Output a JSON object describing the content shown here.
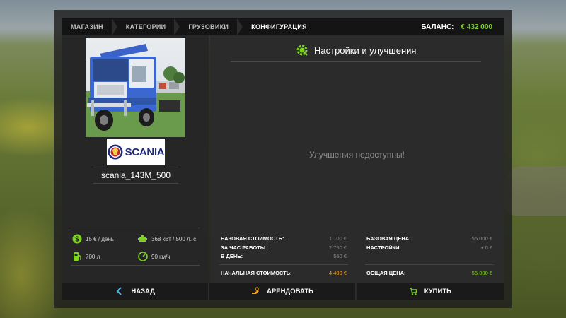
{
  "breadcrumbs": [
    {
      "label": "МАГАЗИН"
    },
    {
      "label": "КАТЕГОРИИ"
    },
    {
      "label": "ГРУЗОВИКИ"
    },
    {
      "label": "КОНФИГУРАЦИЯ"
    }
  ],
  "balance": {
    "label": "БАЛАНС:",
    "value": "€ 432 000"
  },
  "vehicle": {
    "brand": "SCANIA",
    "model": "scania_143M_500",
    "specs": {
      "upkeep": "15 € / день",
      "power": "368 кВт / 500 л. с.",
      "fuel": "700 л",
      "speed": "90 км/ч"
    }
  },
  "settings": {
    "title": "Настройки и улучшения",
    "empty_message": "Улучшения недоступны!"
  },
  "lease": {
    "base_cost_label": "БАЗОВАЯ СТОИМОСТЬ:",
    "base_cost": "1 100 €",
    "per_hour_label": "ЗА ЧАС РАБОТЫ:",
    "per_hour": "2 750 €",
    "per_day_label": "В ДЕНЬ:",
    "per_day": "550 €",
    "initial_cost_label": "НАЧАЛЬНАЯ СТОИМОСТЬ:",
    "initial_cost": "4 400 €"
  },
  "purchase": {
    "base_price_label": "БАЗОВАЯ ЦЕНА:",
    "base_price": "55 000 €",
    "settings_label": "НАСТРОЙКИ:",
    "settings_price": "+ 0 €",
    "total_label": "ОБЩАЯ ЦЕНА:",
    "total_price": "55 000 €"
  },
  "buttons": {
    "back": "НАЗАД",
    "lease": "АРЕНДОВАТЬ",
    "buy": "КУПИТЬ"
  },
  "colors": {
    "accent_green": "#7ed321",
    "accent_orange": "#f5a623"
  },
  "icons": {
    "upkeep": "coin-icon",
    "power": "engine-icon",
    "fuel": "fuel-pump-icon",
    "speed": "speedometer-icon",
    "settings": "gear-wrench-icon",
    "back": "chevron-left-icon",
    "lease": "hand-key-icon",
    "buy": "cart-icon"
  }
}
